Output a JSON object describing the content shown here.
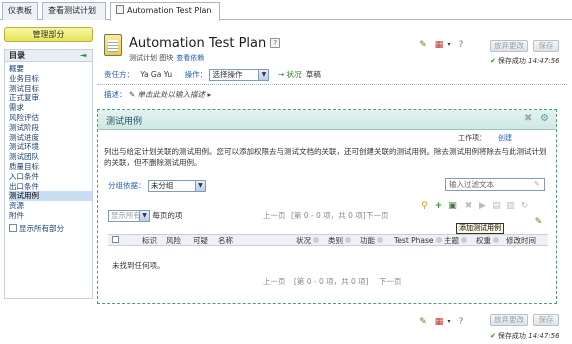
{
  "tabs": [
    {
      "label": "仪表板"
    },
    {
      "label": "查看测试计划"
    },
    {
      "label": "Automation Test Plan"
    }
  ],
  "sidebar": {
    "manage_button": "管理部分",
    "toc_title": "目录",
    "items": [
      "概要",
      "业务目标",
      "测试目标",
      "正式复审",
      "需求",
      "风险评估",
      "测试阶段",
      "测试进度",
      "测试环境",
      "测试团队",
      "质量目标",
      "入口条件",
      "出口条件",
      "测试用例",
      "资源",
      "附件"
    ],
    "selected_index": 13,
    "show_all_label": "显示所有部分"
  },
  "header": {
    "title": "Automation Test Plan",
    "help": "?",
    "subtitle_type": "测试计划 图块",
    "subtitle_link": "查看依赖",
    "buttons": {
      "discard": "放弃更改",
      "save": "保存"
    },
    "saved_label": "保存成功",
    "saved_time": "14:47:56"
  },
  "owner_row": {
    "owner_label": "责任方：",
    "owner_value": "Ya Ga Yu",
    "action_label": "操作：",
    "action_select": "选择操作",
    "status_label": "→ 状况",
    "status_value": "草稿"
  },
  "description": {
    "label": "描述：",
    "placeholder": "✎ 单击此处以输入描述 ▸"
  },
  "panel": {
    "title": "测试用例",
    "work_label": "工作项：",
    "create_link": "创建",
    "desc": "列出与给定计划关联的测试用例。您可以添加权限去与测试文档的关联，还可创建关联的测试用例。除去测试用例将除去与此测试计划的关联，但不删除测试用例。",
    "group_label": "分组依据：",
    "group_select": "未分组",
    "filter_placeholder": "输入过滤文本",
    "show_select": "显示所有",
    "per_page": "每页的项",
    "pager_top": {
      "prev": "上一页",
      "info": "[第 0 - 0 项，共 0 项]",
      "next": "下一页"
    },
    "tooltip": "添加测试用例",
    "columns": [
      "标识",
      "风险",
      "可疑",
      "名称",
      "状况",
      "类别",
      "功能",
      "Test Phase",
      "主题",
      "权重",
      "修改时间"
    ],
    "empty": "未找到任何项。",
    "pager_bottom": {
      "prev": "上一页",
      "info": "[第 0 - 0 项，共 0 项]",
      "next": "下一页"
    }
  },
  "footer": {
    "buttons": {
      "discard": "放弃更改",
      "save": "保存"
    },
    "saved_label": "保存成功",
    "saved_time": "14:47:56"
  }
}
